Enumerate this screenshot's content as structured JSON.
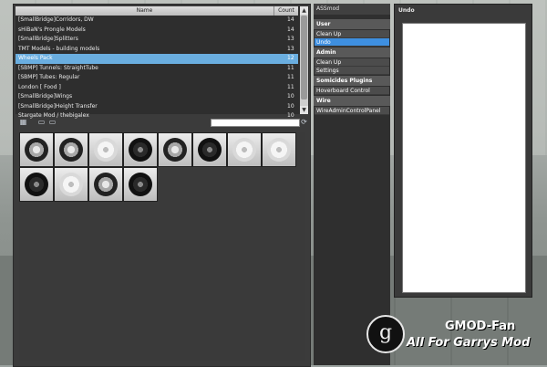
{
  "spawnlist": {
    "columns": {
      "name": "Name",
      "count": "Count"
    },
    "rows": [
      {
        "name": "[SmallBridge]Corridors, DW",
        "count": "14"
      },
      {
        "name": "sHiBaN's Prongle Models",
        "count": "14"
      },
      {
        "name": "[SmallBridge]Splitters",
        "count": "13"
      },
      {
        "name": "TMT Models - building models",
        "count": "13"
      },
      {
        "name": "Wheels Pack",
        "count": "12",
        "selected": true
      },
      {
        "name": "[SBMP] Tunnels: StraightTube",
        "count": "11"
      },
      {
        "name": "[SBMP] Tubes: Regular",
        "count": "11"
      },
      {
        "name": "London [ Food ]",
        "count": "11"
      },
      {
        "name": "[SmallBridge]Wings",
        "count": "10"
      },
      {
        "name": "[SmallBridge]Height Transfer",
        "count": "10"
      },
      {
        "name": "Stargate Mod / thebigalex",
        "count": "10"
      }
    ]
  },
  "sidebar": {
    "title": "ASSmod",
    "categories": [
      {
        "label": "User",
        "items": [
          "Clean Up",
          "Undo"
        ]
      },
      {
        "label": "Admin",
        "items": [
          "Clean Up",
          "Settings"
        ]
      },
      {
        "label": "Somicides Plugins",
        "items": [
          "Hoverboard Control"
        ]
      },
      {
        "label": "Wire",
        "items": [
          "WireAdminControlPanel"
        ]
      }
    ],
    "selected_item": "Undo"
  },
  "undo": {
    "title": "Undo"
  },
  "watermark": {
    "logo": "g",
    "line1": "GMOD-Fan",
    "line2": "All For Garrys Mod"
  },
  "colors": {
    "selection": "#6aaee0",
    "accent": "#3e8fe0"
  },
  "icons": [
    "scroll-up-icon",
    "scroll-down-icon",
    "grid-view-icon",
    "folder-icon",
    "search-go-icon",
    "wheel-icon"
  ]
}
